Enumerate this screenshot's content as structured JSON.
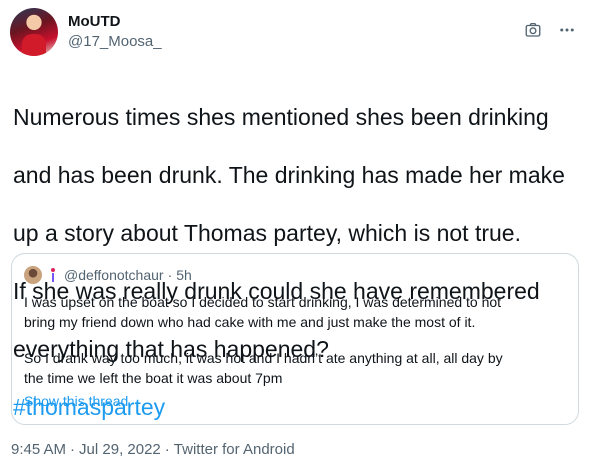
{
  "author": {
    "name": "MoUTD",
    "handle": "@17_Moosa_"
  },
  "tweet": {
    "lines": [
      "Numerous times shes mentioned shes been drinking",
      "and has been drunk. The drinking has made her make",
      "up a story about Thomas  partey, which is not true.",
      "If she was really drunk could she have remembered",
      "everything that has happened?"
    ],
    "hashtag": "#thomaspartey"
  },
  "quote": {
    "handle": "@deffonotchaur",
    "separator": "·",
    "time": "5h",
    "lines": [
      "I was upset on the boat so I decided to start drinking, I was determined to not",
      "bring my friend down who had cake with me and just make the most of it.",
      "So I drank way too much, it was hot and I hadn’t ate anything at all, all day by",
      "the time we left the boat it was about 7pm"
    ],
    "show_thread": "Show this thread"
  },
  "meta": {
    "time": "9:45 AM",
    "sep1": "·",
    "date": "Jul 29, 2022",
    "sep2": "·",
    "source": "Twitter for Android"
  },
  "icons": {
    "top_right": [
      "camera-icon",
      "more-icon"
    ]
  },
  "colors": {
    "link": "#1d9bf0",
    "secondary_text": "#536471",
    "border": "#cfd9de"
  }
}
